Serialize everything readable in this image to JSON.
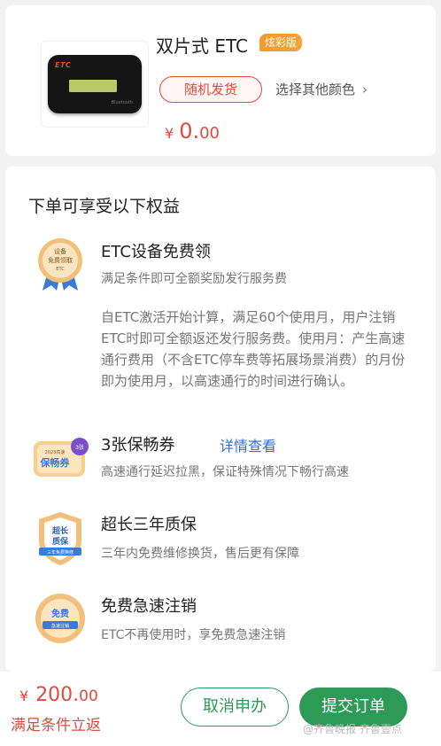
{
  "product": {
    "title": "双片式 ETC",
    "edition_badge": "炫彩版",
    "color_chip": "随机发货",
    "other_colors": "选择其他颜色",
    "price_symbol": "¥",
    "price_int": "0.",
    "price_dec": "00",
    "device_logo": "ETC",
    "device_brand": "Bluetooth",
    "icons": {
      "chevron": "chevron-right-icon"
    }
  },
  "benefits": {
    "title": "下单可享受以下权益",
    "items": [
      {
        "name": "ETC设备免费领",
        "desc": "满足条件即可全额奖励发行服务费",
        "note": "自ETC激活开始计算，满足60个使用月，用户注销ETC时即可全额返还发行服务费。使用月：产生高速通行费用（不含ETC停车费等拓展场景消费）的月份即为使用月，以高速通行的时间进行确认。",
        "icon_text_1": "设备",
        "icon_text_2": "免费领取",
        "icon_text_3": "ETC",
        "icon": "ribbon-medal-icon"
      },
      {
        "name": "3张保畅券",
        "link": "详情查看",
        "desc": "高速通行延迟拉黑，保证特殊情况下畅行高速",
        "icon_text_1": "保畅券",
        "icon_text_2": "2023高速",
        "icon_text_3": "3张",
        "icon": "ticket-icon"
      },
      {
        "name": "超长三年质保",
        "desc": "三年内免费维修换货，售后更有保障",
        "icon_text_1": "超长",
        "icon_text_2": "质保",
        "icon_text_3": "三年免费换修",
        "icon": "shield-badge-icon"
      },
      {
        "name": "免费急速注销",
        "desc": "ETC不再使用时，享免费急速注销",
        "icon_text_1": "免费",
        "icon_text_2": "急速注销",
        "icon": "coin-badge-icon"
      }
    ]
  },
  "bottom": {
    "total_symbol": "¥",
    "total_int": "200.",
    "total_dec": "00",
    "rebate_note": "满足条件立返",
    "cancel_label": "取消申办",
    "submit_label": "提交订单",
    "watermark": "@齐鲁晚报 齐鲁壹点"
  },
  "colors": {
    "accent_red": "#e14a3c",
    "primary_green": "#2e9a58",
    "link_blue": "#2f6fd6",
    "badge_orange": "#f39a2a"
  }
}
